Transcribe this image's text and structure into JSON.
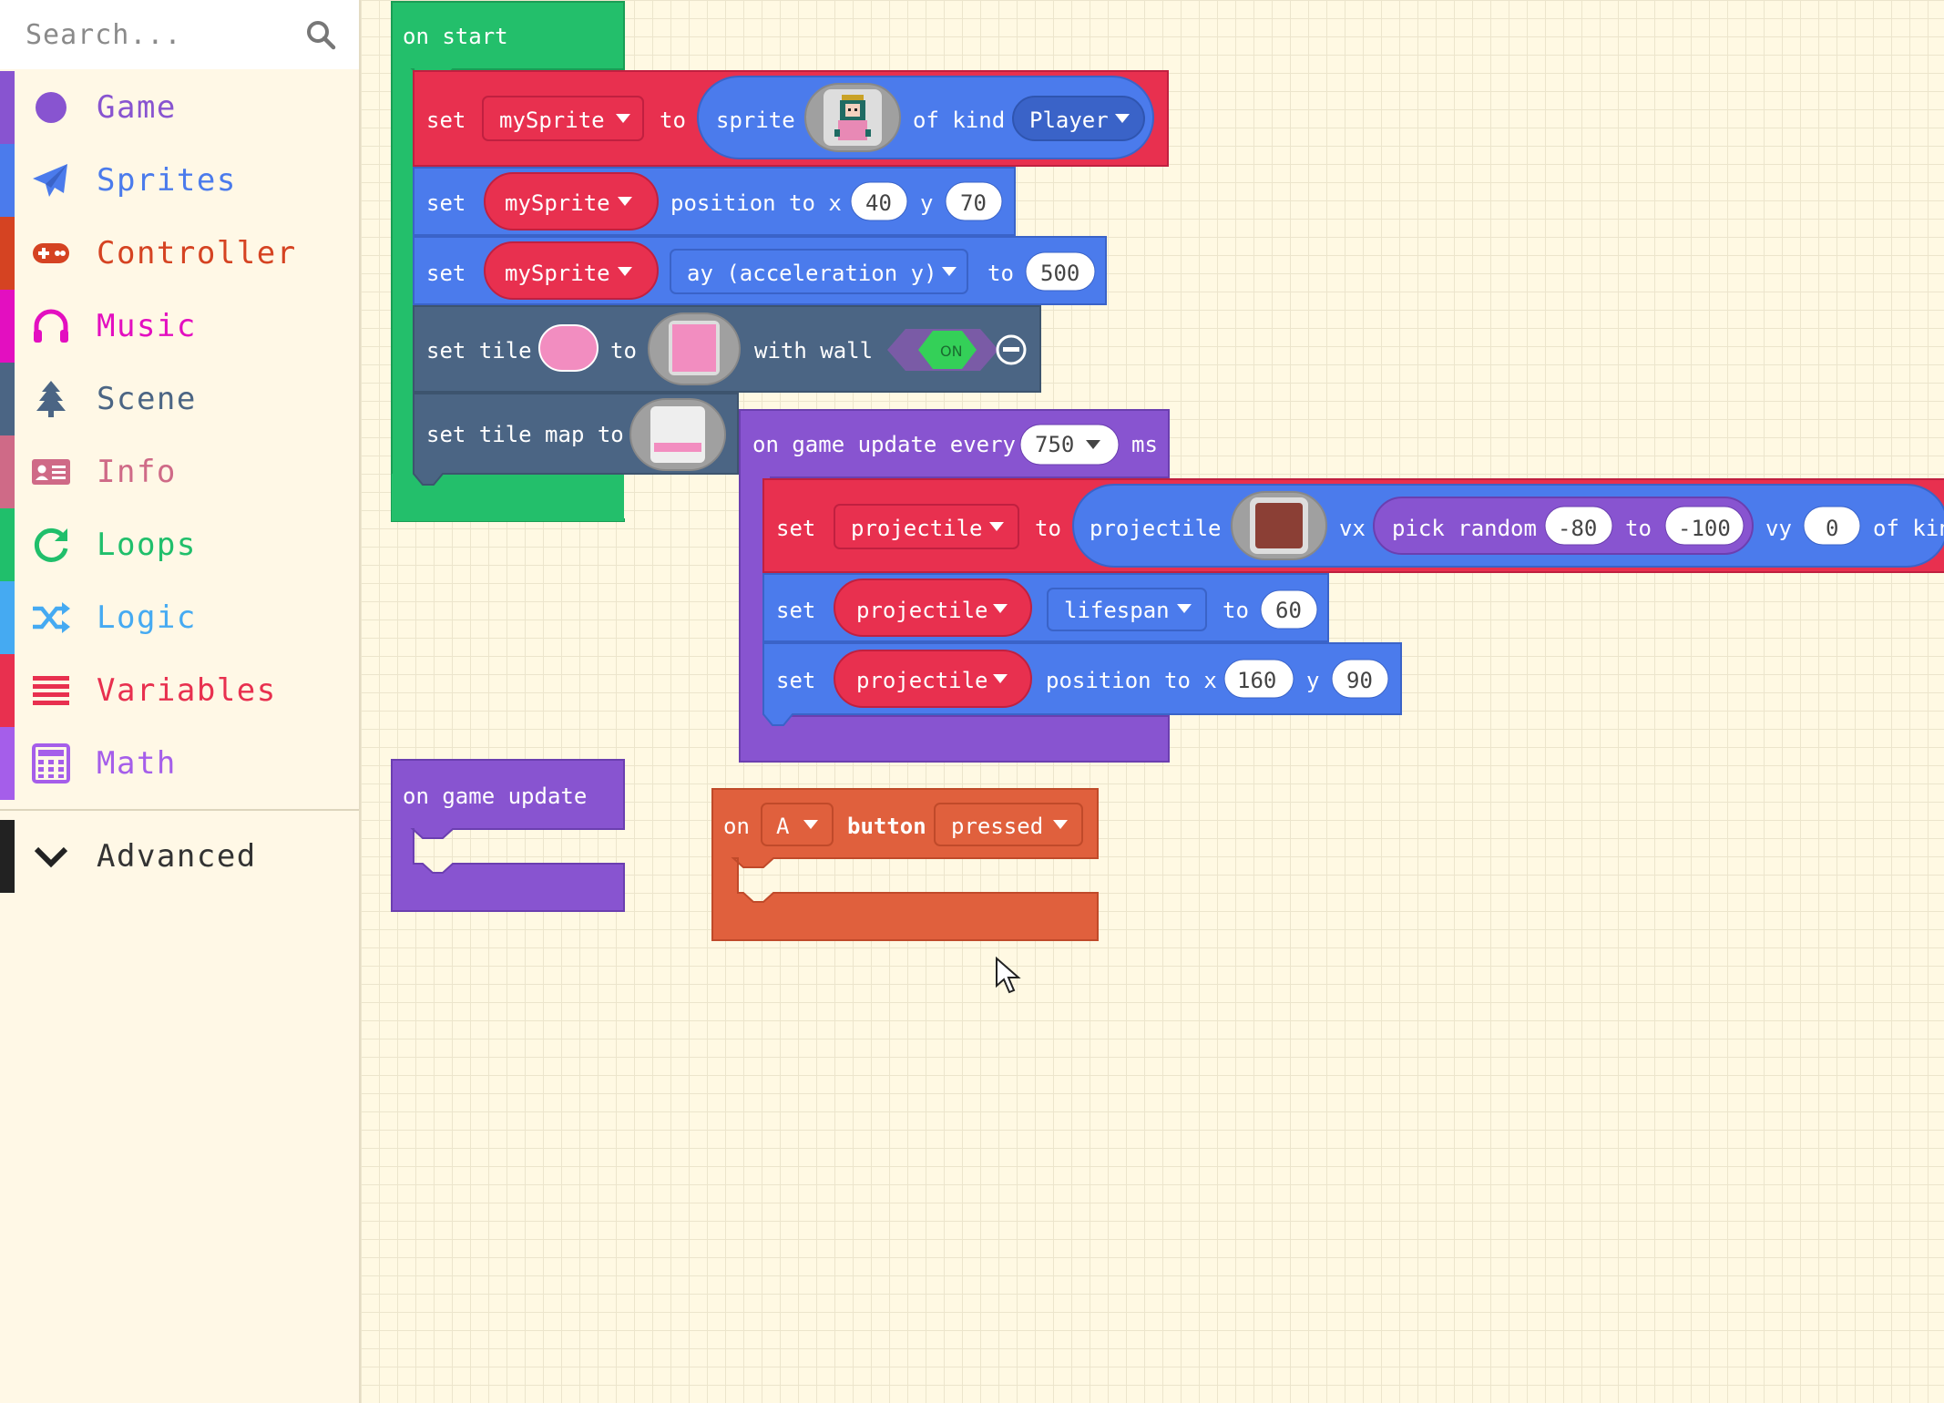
{
  "toolbox": {
    "search_placeholder": "Search...",
    "categories": [
      {
        "label": "Game",
        "color": "#8854d0",
        "icon": "circle-icon"
      },
      {
        "label": "Sprites",
        "color": "#4b7bec",
        "icon": "paper-plane-icon"
      },
      {
        "label": "Controller",
        "color": "#d54322",
        "icon": "gamepad-icon"
      },
      {
        "label": "Music",
        "color": "#e30fc0",
        "icon": "headphones-icon"
      },
      {
        "label": "Scene",
        "color": "#4b6584",
        "icon": "tree-icon"
      },
      {
        "label": "Info",
        "color": "#cf6a87",
        "icon": "id-card-icon"
      },
      {
        "label": "Loops",
        "color": "#20bf6b",
        "icon": "refresh-icon"
      },
      {
        "label": "Logic",
        "color": "#45aaf2",
        "icon": "shuffle-icon"
      },
      {
        "label": "Variables",
        "color": "#e8304f",
        "icon": "list-icon"
      },
      {
        "label": "Math",
        "color": "#a55eea",
        "icon": "calculator-icon"
      }
    ],
    "advanced": {
      "label": "Advanced",
      "color": "#222222",
      "icon": "chevron-down-icon"
    }
  },
  "workspace": {
    "on_start": {
      "hat": "on start",
      "set_sprite": {
        "set": "set",
        "var": "mySprite",
        "to": "to",
        "sprite": "sprite",
        "of_kind": "of kind",
        "kind": "Player"
      },
      "set_position": {
        "set": "set",
        "var": "mySprite",
        "position_to_x": "position to x",
        "x": "40",
        "y_label": "y",
        "y": "70"
      },
      "set_ay": {
        "set": "set",
        "var": "mySprite",
        "prop": "ay (acceleration y)",
        "to": "to",
        "value": "500"
      },
      "set_tile": {
        "set_tile": "set tile",
        "to": "to",
        "with_wall": "with wall",
        "toggle": "ON"
      },
      "set_tilemap": {
        "label": "set tile map to"
      }
    },
    "game_update_every": {
      "hat": "on game update every",
      "interval": "750",
      "unit": "ms",
      "set_projectile": {
        "set": "set",
        "var": "projectile",
        "to": "to",
        "projectile": "projectile",
        "vx": "vx",
        "pick_random": "pick random",
        "min": "-80",
        "to2": "to",
        "max": "-100",
        "vy": "vy",
        "vy_value": "0",
        "of_kind": "of kin"
      },
      "set_lifespan": {
        "set": "set",
        "var": "projectile",
        "prop": "lifespan",
        "to": "to",
        "value": "60"
      },
      "set_position": {
        "set": "set",
        "var": "projectile",
        "position_to_x": "position to x",
        "x": "160",
        "y_label": "y",
        "y": "90"
      }
    },
    "game_update": {
      "hat": "on game update"
    },
    "button_event": {
      "on": "on",
      "button_name": "A",
      "button": "button",
      "event": "pressed"
    }
  },
  "colors": {
    "loops": "#23bf6b",
    "sprites": "#4b7bec",
    "variables": "#e8304f",
    "scene": "#4b6584",
    "game": "#8854d0",
    "controller": "#e0603d",
    "workspace": "#fff9e3"
  }
}
